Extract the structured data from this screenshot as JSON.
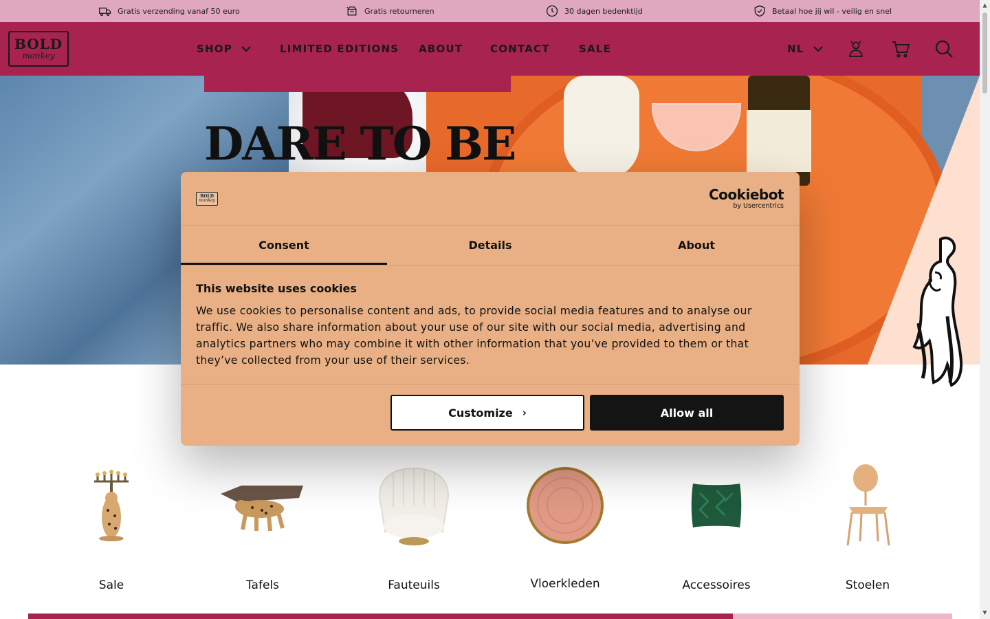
{
  "usp_bar": {
    "items": [
      {
        "icon": "delivery-truck-icon",
        "text": "Gratis verzending vanaf 50 euro"
      },
      {
        "icon": "return-box-icon",
        "text": "Gratis retourneren"
      },
      {
        "icon": "clock-icon",
        "text": "30 dagen bedenktijd"
      },
      {
        "icon": "shield-check-icon",
        "text": "Betaal hoe jij wil - veilig en snel"
      }
    ]
  },
  "header": {
    "logo_line1": "BOLD",
    "logo_line2": "monkey",
    "nav": [
      {
        "label": "SHOP",
        "has_dropdown": true
      },
      {
        "label": "LIMITED EDITIONS"
      },
      {
        "label": "ABOUT"
      },
      {
        "label": "CONTACT"
      },
      {
        "label": "SALE"
      }
    ],
    "language": "NL",
    "icons": [
      "account-icon",
      "cart-icon",
      "search-icon"
    ]
  },
  "hero": {
    "title": "DARE TO BE"
  },
  "categories": [
    {
      "label": "Sale"
    },
    {
      "label": "Tafels"
    },
    {
      "label": "Fauteuils"
    },
    {
      "label": "Vloerkleden"
    },
    {
      "label": "Accessoires"
    },
    {
      "label": "Stoelen"
    }
  ],
  "carousel": {
    "progress": 0.763
  },
  "cookie_dialog": {
    "brand_name": "Cookiebot",
    "brand_sub": "by Usercentrics",
    "tabs": [
      {
        "label": "Consent",
        "active": true
      },
      {
        "label": "Details",
        "active": false
      },
      {
        "label": "About",
        "active": false
      }
    ],
    "heading": "This website uses cookies",
    "body": "We use cookies to personalise content and ads, to provide social media features and to analyse our traffic. We also share information about your use of our site with our social media, advertising and analytics partners who may combine it with other information that you’ve provided to them or that they’ve collected from your use of their services.",
    "customize_label": "Customize",
    "allow_all_label": "Allow all"
  },
  "colors": {
    "usp_bar": "#dfa8bf",
    "header": "#a82350",
    "dialog_bg": "#e8b084",
    "allow_button": "#141414"
  }
}
